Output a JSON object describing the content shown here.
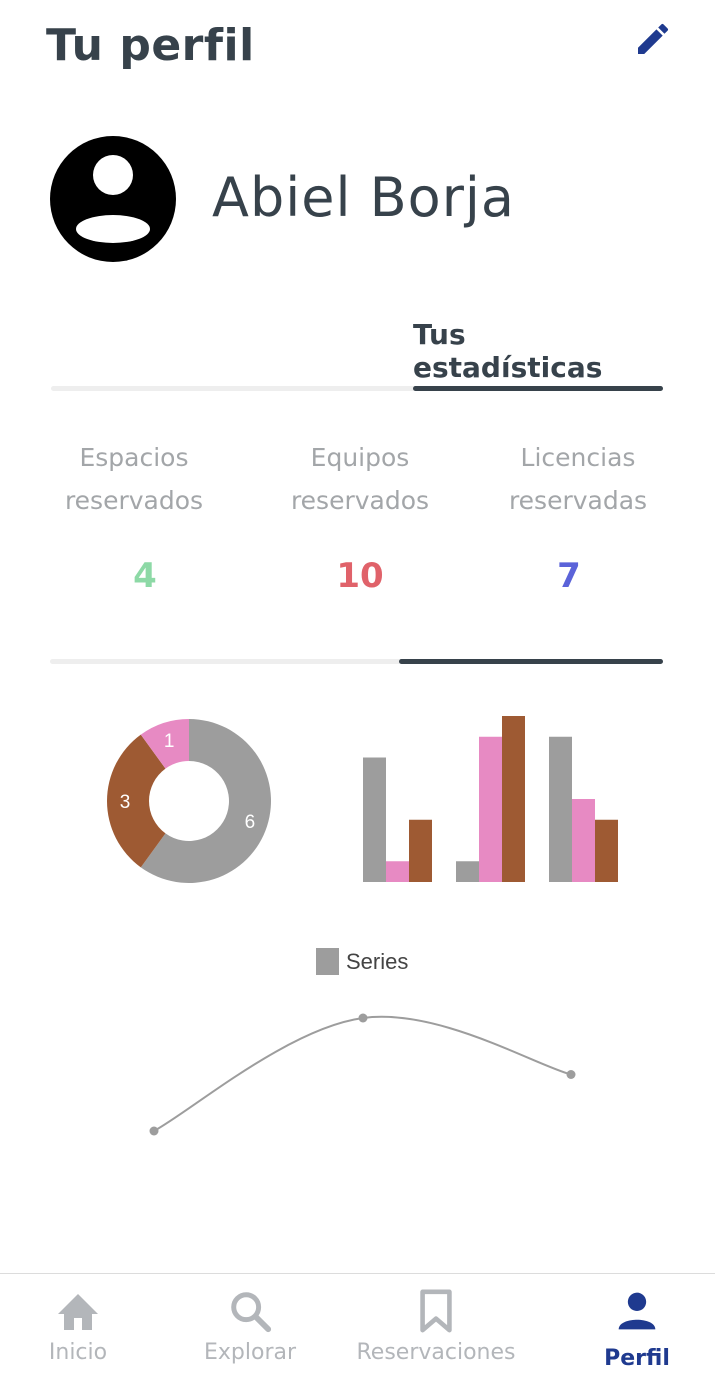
{
  "header": {
    "title": "Tu perfil",
    "edit_icon": "pencil-icon"
  },
  "profile": {
    "name": "Abiel Borja",
    "avatar_icon": "account-circle-icon"
  },
  "tabs": {
    "active_label": "Tus estadísticas"
  },
  "stats": [
    {
      "label_line1": "Espacios",
      "label_line2": "reservados",
      "value": "4",
      "color": "#8dd9a6"
    },
    {
      "label_line1": "Equipos",
      "label_line2": "reservados",
      "value": "10",
      "color": "#e0626a"
    },
    {
      "label_line1": "Licencias",
      "label_line2": "reservadas",
      "value": "7",
      "color": "#5b63d9"
    }
  ],
  "chart_data": [
    {
      "type": "pie",
      "donut": true,
      "labels": [
        "6",
        "3",
        "1"
      ],
      "values": [
        6,
        3,
        1
      ],
      "colors": [
        "#9d9d9d",
        "#9e5a33",
        "#e78ac3"
      ]
    },
    {
      "type": "bar",
      "group_count": 3,
      "series": [
        {
          "values": [
            6,
            1,
            7
          ],
          "color": "#9d9d9d"
        },
        {
          "values": [
            1,
            7,
            4
          ],
          "color": "#e78ac3"
        },
        {
          "values": [
            3,
            8,
            3
          ],
          "color": "#9e5a33"
        }
      ],
      "ylim": [
        0,
        8
      ]
    },
    {
      "type": "line",
      "legend": "Series",
      "legend_color": "#9d9d9d",
      "values": [
        1,
        5,
        3
      ],
      "ylim": [
        1,
        5
      ]
    }
  ],
  "nav": [
    {
      "label": "Inicio",
      "icon": "home-icon",
      "active": false
    },
    {
      "label": "Explorar",
      "icon": "search-icon",
      "active": false
    },
    {
      "label": "Reservaciones",
      "icon": "bookmark-icon",
      "active": false
    },
    {
      "label": "Perfil",
      "icon": "person-icon",
      "active": true
    }
  ],
  "colors": {
    "primary": "#1f3a8f",
    "text_dark": "#37424b",
    "text_muted": "#a3a6a9"
  }
}
